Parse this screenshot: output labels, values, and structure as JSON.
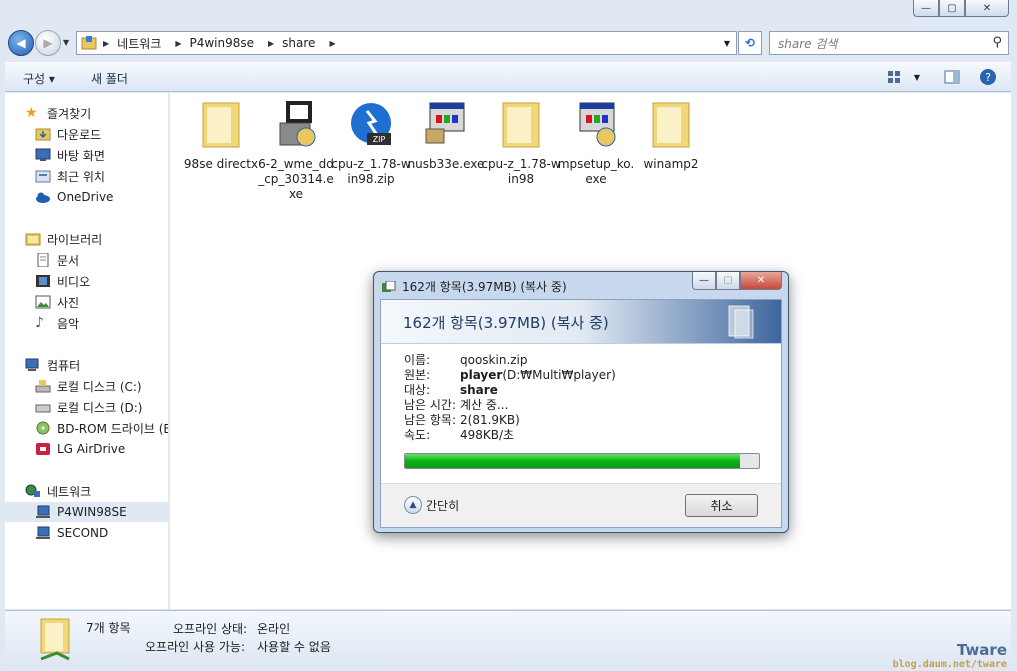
{
  "window": {
    "min": "▭",
    "max": "▢",
    "close": "✕"
  },
  "address": {
    "crumbs": [
      "네트워크",
      "P4win98se",
      "share"
    ],
    "search_placeholder": "share 검색"
  },
  "toolbar": {
    "organize": "구성 ▾",
    "new_folder": "새 폴더"
  },
  "nav": {
    "favorites": "즐겨찾기",
    "downloads": "다운로드",
    "desktop": "바탕 화면",
    "recent": "최근 위치",
    "onedrive": "OneDrive",
    "libraries": "라이브러리",
    "documents": "문서",
    "videos": "비디오",
    "pictures": "사진",
    "music": "음악",
    "computer": "컴퓨터",
    "drive_c": "로컬 디스크 (C:)",
    "drive_d": "로컬 디스크 (D:)",
    "bd_rom": "BD-ROM 드라이브 (E",
    "airdrive": "LG AirDrive",
    "network": "네트워크",
    "p4win98se": "P4WIN98SE",
    "second": "SECOND"
  },
  "files": [
    {
      "name": "98se directx",
      "type": "folder"
    },
    {
      "name": "6-2_wme_dd_cp_30314.exe",
      "type": "installer"
    },
    {
      "name": "cpu-z_1.78-win98.zip",
      "type": "zip"
    },
    {
      "name": "nusb33e.exe",
      "type": "exe"
    },
    {
      "name": "cpu-z_1.78-win98",
      "type": "folder"
    },
    {
      "name": "mpsetup_ko.exe",
      "type": "installer2"
    },
    {
      "name": "winamp2",
      "type": "folder"
    }
  ],
  "status": {
    "count": "7개 항목",
    "offline_status_label": "오프라인 상태:",
    "offline_status_value": "온라인",
    "offline_avail_label": "오프라인 사용 가능:",
    "offline_avail_value": "사용할 수 없음"
  },
  "dialog": {
    "title": "162개 항목(3.97MB) (복사 중)",
    "header": "162개 항목(3.97MB) (복사 중)",
    "rows": [
      {
        "k": "이름:",
        "v": "qooskin.zip",
        "bold": false
      },
      {
        "k": "원본:",
        "v_bold": "player",
        "v": " (D:₩Multi₩player)",
        "bold": true
      },
      {
        "k": "대상:",
        "v_bold": "share",
        "v": "",
        "bold": true
      },
      {
        "k": "남은 시간:",
        "v": "계산 중...",
        "bold": false
      },
      {
        "k": "남은 항목:",
        "v": "2(81.9KB)",
        "bold": false
      },
      {
        "k": "속도:",
        "v": "498KB/초",
        "bold": false
      }
    ],
    "progress": 0.945,
    "less_details": "간단히",
    "cancel": "취소"
  },
  "watermark": {
    "brand": "Tware",
    "url": "blog.daum.net/tware"
  }
}
